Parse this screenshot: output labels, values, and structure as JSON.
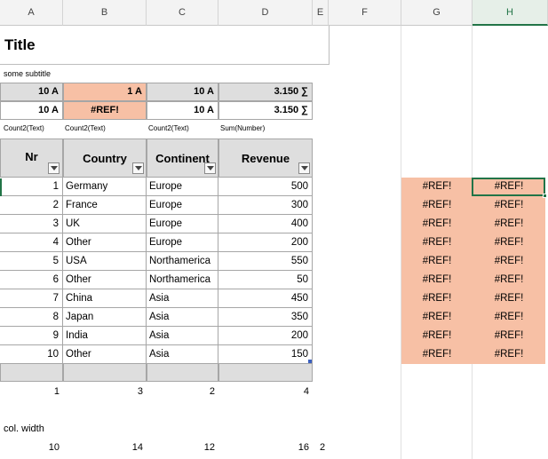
{
  "columns": [
    "A",
    "B",
    "C",
    "D",
    "E",
    "F",
    "G",
    "H"
  ],
  "title": "Title",
  "subtitle": "some subtitle",
  "summary_rows": [
    [
      "10 A",
      "1 A",
      "10 A",
      "3.150 ∑"
    ],
    [
      "10 A",
      "#REF!",
      "10 A",
      "3.150 ∑"
    ]
  ],
  "func_labels": [
    "Count2(Text)",
    "Count2(Text)",
    "Count2(Text)",
    "Sum(Number)"
  ],
  "headers": [
    "Nr",
    "Country",
    "Continent",
    "Revenue"
  ],
  "rows": [
    {
      "nr": "1",
      "country": "Germany",
      "continent": "Europe",
      "revenue": "500"
    },
    {
      "nr": "2",
      "country": "France",
      "continent": "Europe",
      "revenue": "300"
    },
    {
      "nr": "3",
      "country": "UK",
      "continent": "Europe",
      "revenue": "400"
    },
    {
      "nr": "4",
      "country": "Other",
      "continent": "Europe",
      "revenue": "200"
    },
    {
      "nr": "5",
      "country": "USA",
      "continent": "Northamerica",
      "revenue": "550"
    },
    {
      "nr": "6",
      "country": "Other",
      "continent": "Northamerica",
      "revenue": "50"
    },
    {
      "nr": "7",
      "country": "China",
      "continent": "Asia",
      "revenue": "450"
    },
    {
      "nr": "8",
      "country": "Japan",
      "continent": "Asia",
      "revenue": "350"
    },
    {
      "nr": "9",
      "country": "India",
      "continent": "Asia",
      "revenue": "200"
    },
    {
      "nr": "10",
      "country": "Other",
      "continent": "Asia",
      "revenue": "150"
    }
  ],
  "ref_error": "#REF!",
  "index_numbers": [
    "1",
    "3",
    "2",
    "4"
  ],
  "col_width_label": "col. width",
  "col_widths": [
    "10",
    "14",
    "12",
    "16",
    "2"
  ],
  "colors": {
    "header_gray": "#dedede",
    "error_salmon": "#f7c0a5",
    "selection_green": "#227447"
  }
}
